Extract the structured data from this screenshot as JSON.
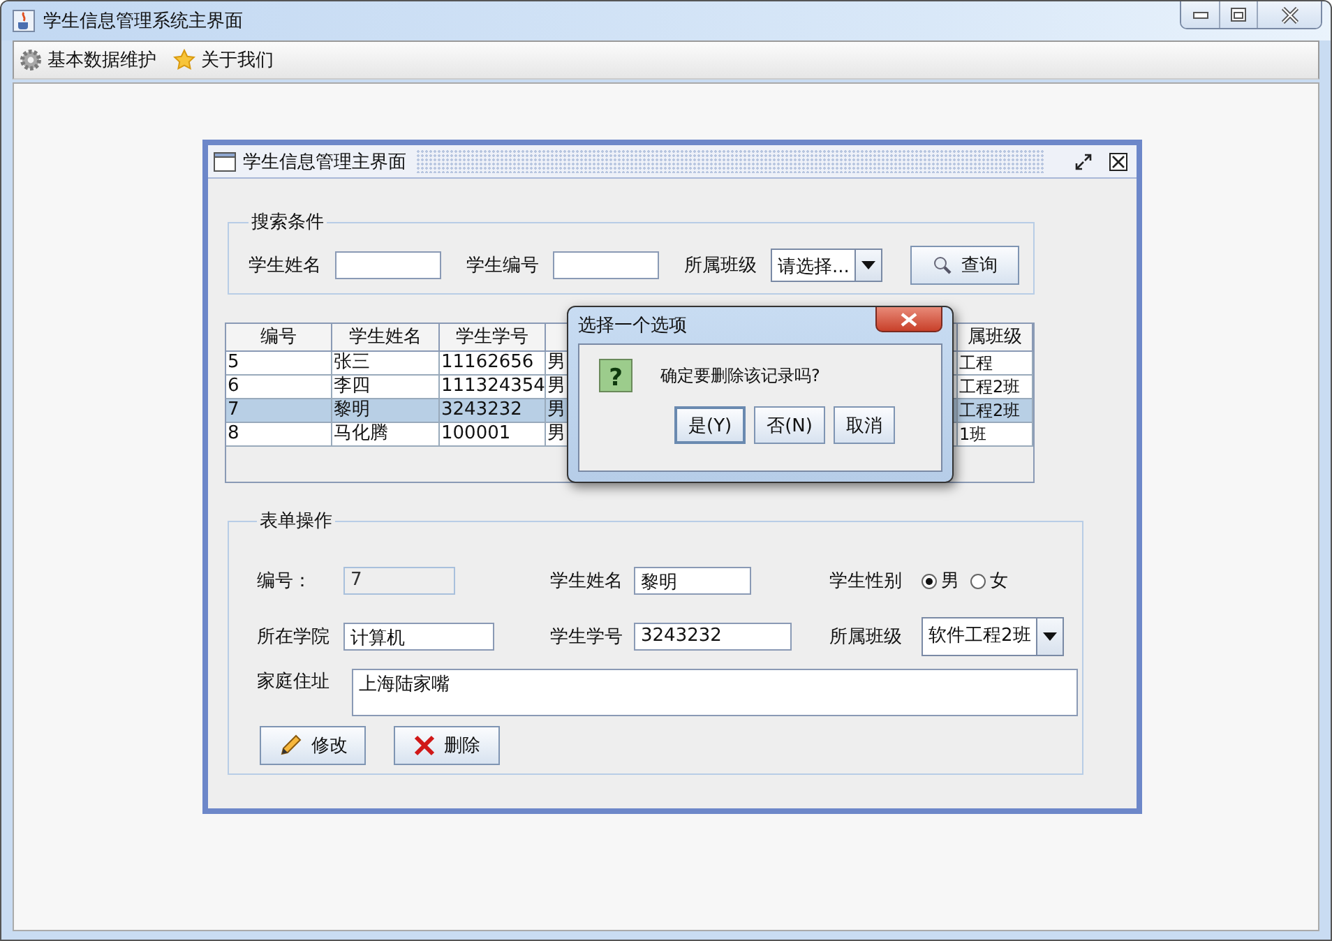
{
  "window": {
    "title": "学生信息管理系统主界面"
  },
  "menu": [
    {
      "label": "基本数据维护",
      "kind": "gear"
    },
    {
      "label": "关于我们",
      "kind": "star"
    }
  ],
  "frame": {
    "title": "学生信息管理主界面",
    "search": {
      "legend": "搜索条件",
      "fields": [
        {
          "label": "学生姓名",
          "kind": "text"
        },
        {
          "label": "学生编号",
          "kind": "text"
        },
        {
          "label": "所属班级",
          "kind": "combo",
          "value": "请选择..."
        }
      ],
      "button": "查询"
    },
    "table": {
      "columns": [
        {
          "label": "编号"
        },
        {
          "label": "学生姓名"
        },
        {
          "label": "学生学号"
        },
        {},
        {
          "label": "属班级"
        }
      ],
      "rows": [
        {
          "cells": [
            "5",
            "张三",
            "11162656",
            "男",
            "工程"
          ],
          "selected": false
        },
        {
          "cells": [
            "6",
            "李四",
            "111324354",
            "男",
            "工程2班"
          ],
          "selected": false
        },
        {
          "cells": [
            "7",
            "黎明",
            "3243232",
            "男",
            "工程2班"
          ],
          "selected": true
        },
        {
          "cells": [
            "8",
            "马化腾",
            "100001",
            "男",
            "1班"
          ],
          "selected": false
        }
      ]
    },
    "form": {
      "legend": "表单操作",
      "rows": [
        [
          {
            "label": "编号：",
            "kind": "readonly",
            "value": "7"
          },
          {
            "label": "学生姓名",
            "kind": "text",
            "value": "黎明"
          },
          {
            "label": "学生性别",
            "kind": "radio",
            "options": [
              {
                "label": "男",
                "selected": true
              },
              {
                "label": "女",
                "selected": false
              }
            ]
          }
        ],
        [
          {
            "label": "所在学院",
            "kind": "text",
            "value": "计算机"
          },
          {
            "label": "学生学号",
            "kind": "text",
            "value": "3243232"
          },
          {
            "label": "所属班级",
            "kind": "combo",
            "value": "软件工程2班"
          }
        ],
        [
          {
            "label": "家庭住址",
            "kind": "textarea",
            "value": "上海陆家嘴"
          }
        ]
      ],
      "buttons": [
        {
          "label": "修改",
          "kind": "edit"
        },
        {
          "label": "删除",
          "kind": "delete"
        }
      ]
    }
  },
  "dialog": {
    "title": "选择一个选项",
    "icon": "?",
    "message": "确定要删除该记录吗?",
    "buttons": [
      {
        "label": "是(Y)",
        "focused": true
      },
      {
        "label": "否(N)",
        "focused": false
      },
      {
        "label": "取消",
        "focused": false
      }
    ]
  }
}
